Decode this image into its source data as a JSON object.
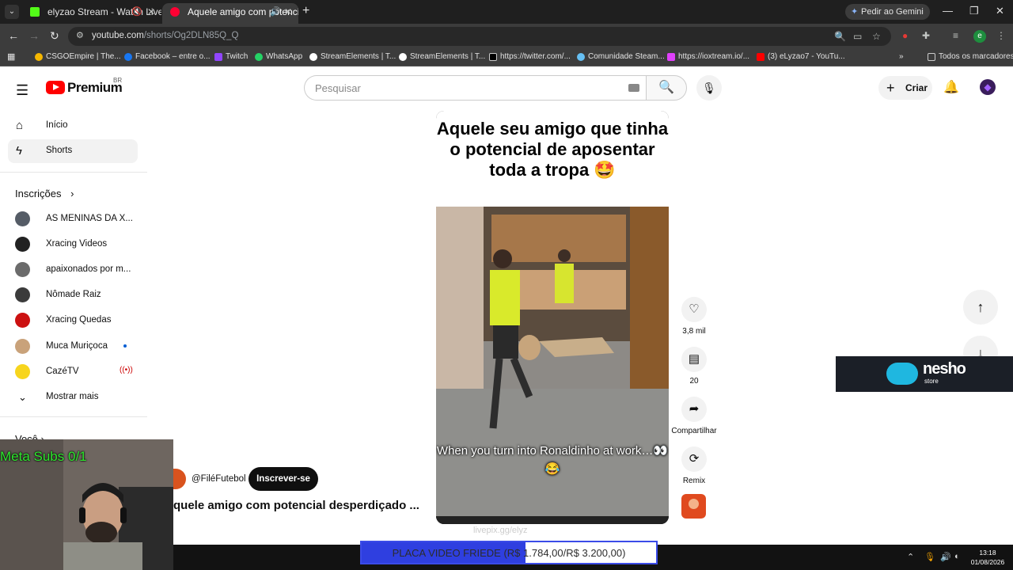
{
  "browser": {
    "tabs": [
      {
        "title": "elyzao Stream - Watch Live",
        "favicon_color": "#53fc18",
        "active": false
      },
      {
        "title": "Aquele amigo com potencial",
        "favicon_color": "#ff0033",
        "active": true
      }
    ],
    "gemini_label": "Pedir ao Gemini",
    "url_host": "youtube.com",
    "url_path": "/shorts/Og2DLN85Q_Q",
    "profile_initial": "e",
    "bookmarks": [
      {
        "label": "CSGOEmpire | The...",
        "color": "#f5b700"
      },
      {
        "label": "Facebook – entre o...",
        "color": "#1877f2"
      },
      {
        "label": "Twitch",
        "color": "#9146ff"
      },
      {
        "label": "WhatsApp",
        "color": "#25d366"
      },
      {
        "label": "StreamElements | T...",
        "color": "#ffffff"
      },
      {
        "label": "StreamElements | T...",
        "color": "#ffffff"
      },
      {
        "label": "https://twitter.com/...",
        "color": "#ffffff"
      },
      {
        "label": "Comunidade Steam...",
        "color": "#66c0f4"
      },
      {
        "label": "https://ioxtream.io/...",
        "color": "#e040fb"
      },
      {
        "label": "(3) eLyzao7 - YouTu...",
        "color": "#ff0000"
      }
    ],
    "all_bookmarks_label": "Todos os marcadores"
  },
  "youtube": {
    "logo_text": "Premium",
    "region": "BR",
    "search_placeholder": "Pesquisar",
    "create_label": "Criar",
    "sidebar": {
      "main": [
        {
          "label": "Início",
          "icon": "home-icon"
        },
        {
          "label": "Shorts",
          "icon": "shorts-icon",
          "active": true
        }
      ],
      "subscriptions_title": "Inscrições",
      "subscriptions": [
        {
          "name": "AS MENINAS DA X...",
          "color": "#555c66"
        },
        {
          "name": "Xracing Videos",
          "color": "#222222"
        },
        {
          "name": "apaixonados por m...",
          "color": "#6b6b6b"
        },
        {
          "name": "Nômade Raiz",
          "color": "#3b3b3b"
        },
        {
          "name": "Xracing Quedas",
          "color": "#cc1111"
        },
        {
          "name": "Muca Muriçoca",
          "color": "#c9a27a",
          "new": true
        },
        {
          "name": "CazéTV",
          "color": "#f7d51d",
          "live": true
        }
      ],
      "show_more": "Mostrar mais",
      "you_title": "Você"
    },
    "short": {
      "caption": "Aquele seu amigo que tinha o potencial de aposentar toda a tropa 🤩",
      "subtitle": "When you turn into Ronaldinho at work…👀😂",
      "channel": "@FiléFutebol",
      "subscribe": "Inscrever-se",
      "title": "quele amigo com potencial desperdiçado ...",
      "watermark": "livepix.gg/elyz"
    },
    "actions": [
      {
        "icon": "like-icon",
        "glyph": "♡",
        "label": "3,8 mil"
      },
      {
        "icon": "comment-icon",
        "glyph": "▤",
        "label": "20"
      },
      {
        "icon": "share-icon",
        "glyph": "➦",
        "label": "Compartilhar"
      },
      {
        "icon": "remix-icon",
        "glyph": "⟳",
        "label": "Remix"
      }
    ]
  },
  "overlays": {
    "sponsor": "nesho",
    "sponsor_sub": "store",
    "meta_subs": "Meta Subs 0/1",
    "goal_text": "PLACA VIDEO FRIEDE (R$ 1.784,00/R$ 3.200,00)",
    "goal_progress": 0.5575
  },
  "taskbar": {
    "time": "13:18",
    "date": "01/08/2026"
  }
}
